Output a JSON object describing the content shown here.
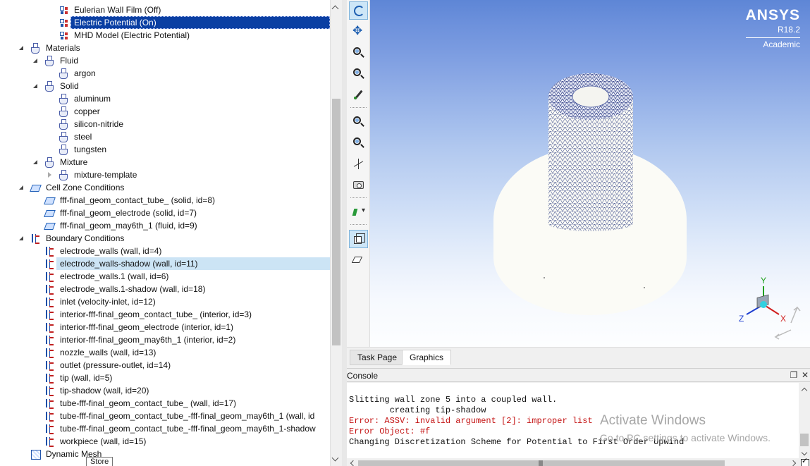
{
  "tree": [
    {
      "label": "Eulerian Wall Film (Off)",
      "icon": "model-icon",
      "depth": 3,
      "expander": "none",
      "state": ""
    },
    {
      "label": "Electric Potential (On)",
      "icon": "model-icon",
      "depth": 3,
      "expander": "none",
      "state": "selected"
    },
    {
      "label": "MHD Model (Electric Potential)",
      "icon": "model-icon",
      "depth": 3,
      "expander": "none",
      "state": ""
    },
    {
      "label": "Materials",
      "icon": "flask-icon",
      "depth": 1,
      "expander": "open",
      "state": ""
    },
    {
      "label": "Fluid",
      "icon": "flask-icon",
      "depth": 2,
      "expander": "open",
      "state": ""
    },
    {
      "label": "argon",
      "icon": "flask-icon",
      "depth": 3,
      "expander": "none",
      "state": ""
    },
    {
      "label": "Solid",
      "icon": "flask-icon",
      "depth": 2,
      "expander": "open",
      "state": ""
    },
    {
      "label": "aluminum",
      "icon": "flask-icon",
      "depth": 3,
      "expander": "none",
      "state": ""
    },
    {
      "label": "copper",
      "icon": "flask-icon",
      "depth": 3,
      "expander": "none",
      "state": ""
    },
    {
      "label": "silicon-nitride",
      "icon": "flask-icon",
      "depth": 3,
      "expander": "none",
      "state": ""
    },
    {
      "label": "steel",
      "icon": "flask-icon",
      "depth": 3,
      "expander": "none",
      "state": ""
    },
    {
      "label": "tungsten",
      "icon": "flask-icon",
      "depth": 3,
      "expander": "none",
      "state": ""
    },
    {
      "label": "Mixture",
      "icon": "flask-icon",
      "depth": 2,
      "expander": "open",
      "state": ""
    },
    {
      "label": "mixture-template",
      "icon": "flask-icon",
      "depth": 3,
      "expander": "closed",
      "state": ""
    },
    {
      "label": "Cell Zone Conditions",
      "icon": "cube-icon",
      "depth": 1,
      "expander": "open",
      "state": ""
    },
    {
      "label": "fff-final_geom_contact_tube_ (solid, id=8)",
      "icon": "cube-icon",
      "depth": 2,
      "expander": "none",
      "state": ""
    },
    {
      "label": "fff-final_geom_electrode (solid, id=7)",
      "icon": "cube-icon",
      "depth": 2,
      "expander": "none",
      "state": ""
    },
    {
      "label": "fff-final_geom_may6th_1 (fluid, id=9)",
      "icon": "cube-icon",
      "depth": 2,
      "expander": "none",
      "state": ""
    },
    {
      "label": "Boundary Conditions",
      "icon": "boundary-icon",
      "depth": 1,
      "expander": "open",
      "state": ""
    },
    {
      "label": "electrode_walls (wall, id=4)",
      "icon": "boundary-icon",
      "depth": 2,
      "expander": "none",
      "state": ""
    },
    {
      "label": "electrode_walls-shadow (wall, id=11)",
      "icon": "boundary-icon",
      "depth": 2,
      "expander": "none",
      "state": "hover"
    },
    {
      "label": "electrode_walls.1 (wall, id=6)",
      "icon": "boundary-icon",
      "depth": 2,
      "expander": "none",
      "state": ""
    },
    {
      "label": "electrode_walls.1-shadow (wall, id=18)",
      "icon": "boundary-icon",
      "depth": 2,
      "expander": "none",
      "state": ""
    },
    {
      "label": "inlet (velocity-inlet, id=12)",
      "icon": "boundary-icon",
      "depth": 2,
      "expander": "none",
      "state": ""
    },
    {
      "label": "interior-fff-final_geom_contact_tube_ (interior, id=3)",
      "icon": "boundary-icon",
      "depth": 2,
      "expander": "none",
      "state": ""
    },
    {
      "label": "interior-fff-final_geom_electrode (interior, id=1)",
      "icon": "boundary-icon",
      "depth": 2,
      "expander": "none",
      "state": ""
    },
    {
      "label": "interior-fff-final_geom_may6th_1 (interior, id=2)",
      "icon": "boundary-icon",
      "depth": 2,
      "expander": "none",
      "state": ""
    },
    {
      "label": "nozzle_walls (wall, id=13)",
      "icon": "boundary-icon",
      "depth": 2,
      "expander": "none",
      "state": ""
    },
    {
      "label": "outlet (pressure-outlet, id=14)",
      "icon": "boundary-icon",
      "depth": 2,
      "expander": "none",
      "state": ""
    },
    {
      "label": "tip (wall, id=5)",
      "icon": "boundary-icon",
      "depth": 2,
      "expander": "none",
      "state": ""
    },
    {
      "label": "tip-shadow (wall, id=20)",
      "icon": "boundary-icon",
      "depth": 2,
      "expander": "none",
      "state": ""
    },
    {
      "label": "tube-fff-final_geom_contact_tube_ (wall, id=17)",
      "icon": "boundary-icon",
      "depth": 2,
      "expander": "none",
      "state": ""
    },
    {
      "label": "tube-fff-final_geom_contact_tube_-fff-final_geom_may6th_1 (wall, id",
      "icon": "boundary-icon",
      "depth": 2,
      "expander": "none",
      "state": ""
    },
    {
      "label": "tube-fff-final_geom_contact_tube_-fff-final_geom_may6th_1-shadow",
      "icon": "boundary-icon",
      "depth": 2,
      "expander": "none",
      "state": ""
    },
    {
      "label": "workpiece (wall, id=15)",
      "icon": "boundary-icon",
      "depth": 2,
      "expander": "none",
      "state": ""
    },
    {
      "label": "Dynamic Mesh",
      "icon": "mesh-icon",
      "depth": 1,
      "expander": "none",
      "state": ""
    }
  ],
  "tooltip": "Store",
  "toolbar": [
    {
      "name": "rotate-icon",
      "cls": "rotate",
      "active": true
    },
    {
      "name": "pan-icon",
      "cls": "pan",
      "active": false
    },
    {
      "name": "zoom-in-icon",
      "cls": "zoom",
      "active": false
    },
    {
      "name": "zoom-to-fit-icon",
      "cls": "zoom",
      "active": false
    },
    {
      "name": "probe-icon",
      "cls": "probe",
      "active": false
    },
    {
      "name": "sep",
      "cls": "sep"
    },
    {
      "name": "zoom-box-icon",
      "cls": "zoom",
      "active": false
    },
    {
      "name": "zoom-out-icon",
      "cls": "zoom",
      "active": false
    },
    {
      "name": "axes-fit-icon",
      "cls": "fit",
      "active": false
    },
    {
      "name": "camera-icon",
      "cls": "camera",
      "active": false
    },
    {
      "name": "sep",
      "cls": "sep"
    },
    {
      "name": "views-dropdown-icon",
      "cls": "views",
      "active": false
    },
    {
      "name": "sep",
      "cls": "sep"
    },
    {
      "name": "perspective-view-icon",
      "cls": "box3d",
      "active": true
    },
    {
      "name": "orthographic-view-icon",
      "cls": "box3dw",
      "active": false
    }
  ],
  "logo": {
    "name": "ANSYS",
    "version": "R18.2",
    "edition": "Academic"
  },
  "axes": {
    "x": "X",
    "y": "Y",
    "z": "Z"
  },
  "tabs": [
    {
      "label": "Task Page",
      "active": false
    },
    {
      "label": "Graphics",
      "active": true
    }
  ],
  "console": {
    "title": "Console",
    "lines": [
      {
        "text": "Slitting wall zone 5 into a coupled wall.",
        "type": "normal"
      },
      {
        "text": "        creating tip-shadow",
        "type": "normal"
      },
      {
        "text": "Error: ASSV: invalid argument [2]: improper list",
        "type": "error"
      },
      {
        "text": "Error Object: #f",
        "type": "error"
      },
      {
        "text": "Changing Discretization Scheme for Potential to First Order Upwind",
        "type": "normal"
      }
    ]
  },
  "watermark": {
    "title": "Activate Windows",
    "subtitle": "Go to PC settings to activate Windows."
  },
  "colors": {
    "selection": "#0a3fa3",
    "hover": "#cce4f5",
    "error_text": "#c41414",
    "mesh_line": "#3b4a8a",
    "body": "#fbfbf6"
  }
}
